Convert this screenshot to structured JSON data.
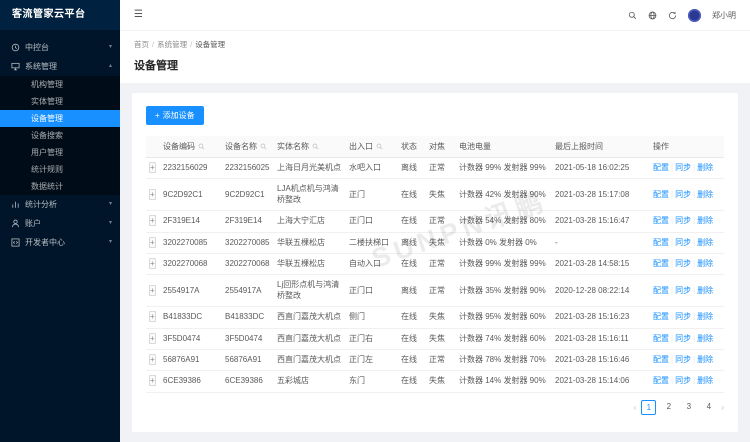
{
  "colors": {
    "accent": "#1890ff",
    "sidebar_bg": "#001529",
    "submenu_bg": "#000c17",
    "page_bg": "#f0f2f5"
  },
  "logo": {
    "title": "客流管家云平台"
  },
  "sidebar": {
    "items": [
      {
        "label": "中控台",
        "icon": "console-icon",
        "chevron": "down"
      },
      {
        "label": "系统管理",
        "icon": "system-icon",
        "chevron": "up",
        "expanded": true,
        "children": [
          {
            "label": "机构管理",
            "active": false
          },
          {
            "label": "实体管理",
            "active": false
          },
          {
            "label": "设备管理",
            "active": true
          },
          {
            "label": "设备搜索",
            "active": false
          },
          {
            "label": "用户管理",
            "active": false
          },
          {
            "label": "统计规则",
            "active": false
          },
          {
            "label": "数据统计",
            "active": false
          }
        ]
      },
      {
        "label": "统计分析",
        "icon": "chart-icon",
        "chevron": "down"
      },
      {
        "label": "账户",
        "icon": "user-icon",
        "chevron": "down"
      },
      {
        "label": "开发者中心",
        "icon": "dev-icon",
        "chevron": "down"
      }
    ]
  },
  "topbar": {
    "user_name": "郑小明"
  },
  "breadcrumb": {
    "items": [
      "首页",
      "系统管理",
      "设备管理"
    ],
    "separator": "/"
  },
  "page": {
    "title": "设备管理"
  },
  "toolbar": {
    "add_label": "添加设备",
    "plus": "+"
  },
  "table": {
    "columns": [
      {
        "label": "设备编码",
        "searchable": true
      },
      {
        "label": "设备名称",
        "searchable": true
      },
      {
        "label": "实体名称",
        "searchable": true
      },
      {
        "label": "出入口",
        "searchable": true
      },
      {
        "label": "状态",
        "searchable": false
      },
      {
        "label": "对焦",
        "searchable": false
      },
      {
        "label": "电池电量",
        "searchable": false
      },
      {
        "label": "最后上报时间",
        "searchable": false
      },
      {
        "label": "操作",
        "searchable": false
      }
    ],
    "actions": [
      "配置",
      "同步",
      "删除"
    ],
    "rows": [
      {
        "code": "2232156029",
        "name": "2232156025",
        "entity": "上海日月光美机点",
        "door": "水吧入口",
        "status": "离线",
        "focus": "正常",
        "battery": "计数器 99% 发射器 99%",
        "time": "2021-05-18 16:02:25"
      },
      {
        "code": "9C2D92C1",
        "name": "9C2D92C1",
        "entity": "LJA机点机与鸿清桥整改",
        "door": "正门",
        "status": "在线",
        "focus": "失焦",
        "battery": "计数器 42% 发射器 90%",
        "time": "2021-03-28 15:17:08"
      },
      {
        "code": "2F319E14",
        "name": "2F319E14",
        "entity": "上海大宁汇店",
        "door": "正门口",
        "status": "在线",
        "focus": "正常",
        "battery": "计数器 54% 发射器 80%",
        "time": "2021-03-28 15:16:47"
      },
      {
        "code": "3202270085",
        "name": "3202270085",
        "entity": "华联五棵松店",
        "door": "二楼扶梯口",
        "status": "离线",
        "focus": "失焦",
        "battery": "计数器 0% 发射器 0%",
        "time": "-"
      },
      {
        "code": "3202270068",
        "name": "3202270068",
        "entity": "华联五棵松店",
        "door": "自动入口",
        "status": "在线",
        "focus": "正常",
        "battery": "计数器 99% 发射器 99%",
        "time": "2021-03-28 14:58:15"
      },
      {
        "code": "2554917A",
        "name": "2554917A",
        "entity": "Lj回形点机与鸿清桥整改",
        "door": "正门口",
        "status": "离线",
        "focus": "正常",
        "battery": "计数器 35% 发射器 90%",
        "time": "2020-12-28 08:22:14"
      },
      {
        "code": "B41833DC",
        "name": "B41833DC",
        "entity": "西直门嘉茂大机点",
        "door": "侧门",
        "status": "在线",
        "focus": "失焦",
        "battery": "计数器 95% 发射器 60%",
        "time": "2021-03-28 15:16:23"
      },
      {
        "code": "3F5D0474",
        "name": "3F5D0474",
        "entity": "西直门嘉茂大机点",
        "door": "正门右",
        "status": "在线",
        "focus": "失焦",
        "battery": "计数器 74% 发射器 60%",
        "time": "2021-03-28 15:16:11"
      },
      {
        "code": "56876A91",
        "name": "56876A91",
        "entity": "西直门嘉茂大机点",
        "door": "正门左",
        "status": "在线",
        "focus": "正常",
        "battery": "计数器 78% 发射器 70%",
        "time": "2021-03-28 15:16:46"
      },
      {
        "code": "6CE39386",
        "name": "6CE39386",
        "entity": "五彩城店",
        "door": "东门",
        "status": "在线",
        "focus": "失焦",
        "battery": "计数器 14% 发射器 90%",
        "time": "2021-03-28 15:14:06"
      }
    ]
  },
  "pagination": {
    "prev": "‹",
    "pages": [
      "1",
      "2",
      "3",
      "4"
    ],
    "active": "1",
    "next": "›"
  },
  "watermark": "SUNPN讯鹏"
}
